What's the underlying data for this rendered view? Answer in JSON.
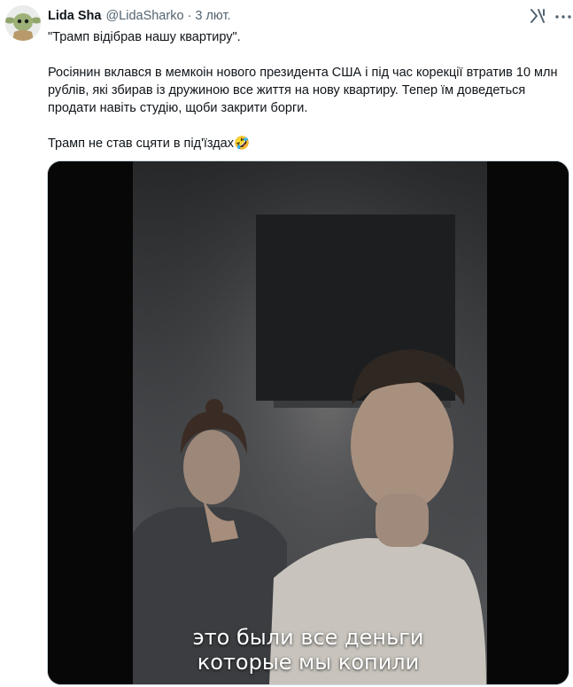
{
  "author": {
    "name": "Lida Sha",
    "handle": "@LidaSharko",
    "separator": "·",
    "date": "3 лют."
  },
  "icons": {
    "grok": "grok-icon",
    "more": "more-dots-icon",
    "avatar": "baby-yoda-avatar"
  },
  "tweet": {
    "line1": "\"Трамп відібрав нашу квартиру\".",
    "paragraph2": "Росіянин вклався в мемкоін нового президента США і під час корекції втратив 10 млн рублів, які збирав із дружиною все життя на нову квартиру. Тепер їм доведеться продати навіть студію, щоби закрити борги.",
    "line3": "Трамп не став сцяти в під'їздах🤣"
  },
  "video": {
    "caption_line1": "это были все деньги",
    "caption_line2": "которые мы копили"
  }
}
